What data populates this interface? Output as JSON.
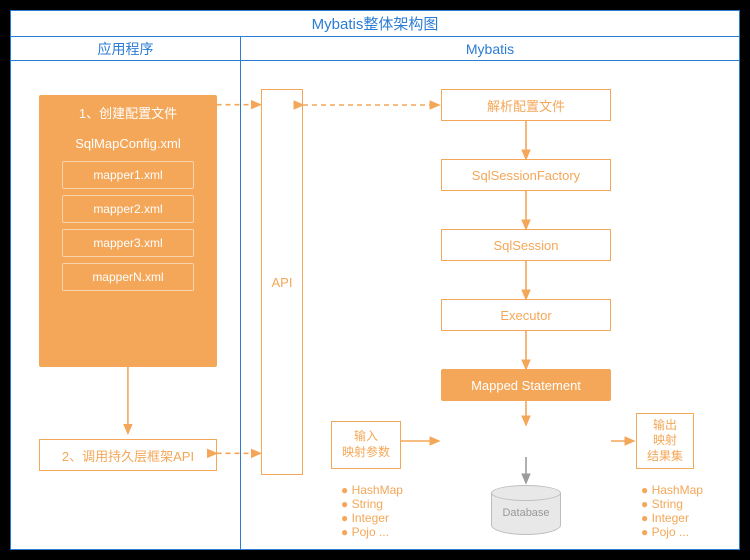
{
  "title": "Mybatis整体架构图",
  "left": {
    "header": "应用程序",
    "step1": "1、创建配置文件",
    "config_file": "SqlMapConfig.xml",
    "mappers": [
      "mapper1.xml",
      "mapper2.xml",
      "mapper3.xml",
      "mapperN.xml"
    ],
    "step2": "2、调用持久层框架API"
  },
  "right": {
    "header": "Mybatis",
    "api": "API",
    "flow": [
      "解析配置文件",
      "SqlSessionFactory",
      "SqlSession",
      "Executor",
      "Mapped Statement"
    ],
    "input": {
      "l1": "输入",
      "l2": "映射参数"
    },
    "output": {
      "l1": "输出",
      "l2": "映射",
      "l3": "结果集"
    },
    "bullets_left": [
      "HashMap",
      "String",
      "Integer",
      "Pojo ..."
    ],
    "bullets_right": [
      "HashMap",
      "String",
      "Integer",
      "Pojo ..."
    ],
    "database": "Database"
  },
  "colors": {
    "frame": "#2b7cd3",
    "orange": "#f4a758"
  }
}
